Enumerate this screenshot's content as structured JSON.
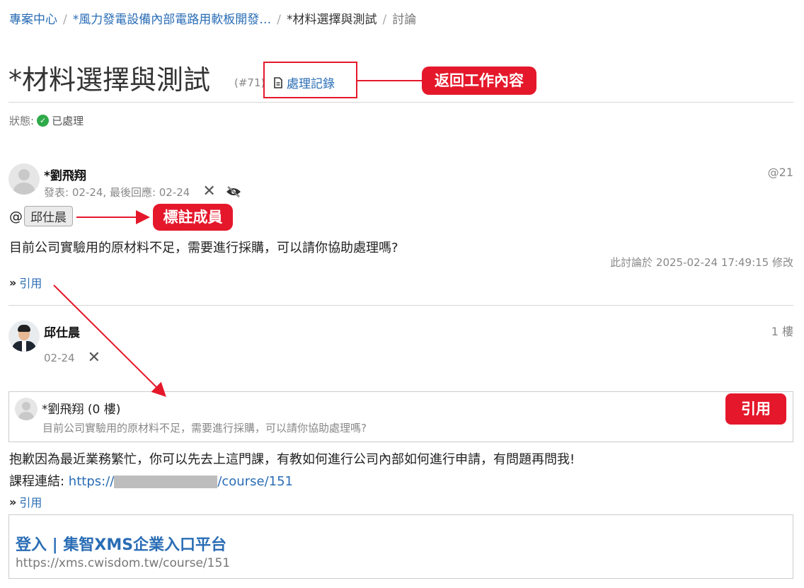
{
  "breadcrumb": {
    "item1": "專案中心",
    "item2": "*風力發電設備內部電路用軟板開發…",
    "item3": "*材料選擇與測試",
    "item4": "討論",
    "sep": "/"
  },
  "page": {
    "title": "*材料選擇與測試",
    "id": "(#71)",
    "record_link": "處理記錄",
    "status_label": "狀態:",
    "status_value": "已處理"
  },
  "post1": {
    "author": "*劉飛翔",
    "meta": "發表: 02-24, 最後回應: 02-24",
    "floor": "@21",
    "mention_at": "@",
    "mention_name": "邱仕晨",
    "content": "目前公司實驗用的原材料不足，需要進行採購，可以請你協助處理嗎?",
    "modified": "此討論於 2025-02-24 17:49:15 修改",
    "quote_label": "引用"
  },
  "post2": {
    "author": "邱仕晨",
    "meta": "02-24",
    "floor": "1 樓",
    "quote_author": "*劉飛翔 (0 樓)",
    "quote_text": "目前公司實驗用的原材料不足，需要進行採購，可以請你協助處理嗎?",
    "content": "抱歉因為最近業務繁忙，你可以先去上這門課，有教如何進行公司內部如何進行申請，有問題再問我!",
    "course_label": "課程連結: ",
    "course_link_start": "https://",
    "course_link_end": "/course/151",
    "quote_label": "引用"
  },
  "link_card": {
    "title": "登入 | 集智XMS企業入口平台",
    "url": "https://xms.cwisdom.tw/course/151"
  },
  "annotations": {
    "back_to_work": "返回工作內容",
    "tag_member": "標註成員",
    "quote": "引用"
  },
  "icons": {
    "record": "document-icon",
    "status": "check-circle-icon",
    "delete": "close-icon",
    "hide": "eye-slash-icon",
    "quote": "double-chevron-right-icon"
  },
  "colors": {
    "link": "#2a6db5",
    "annotation": "#e5182b",
    "ok": "#2eaa4a"
  }
}
